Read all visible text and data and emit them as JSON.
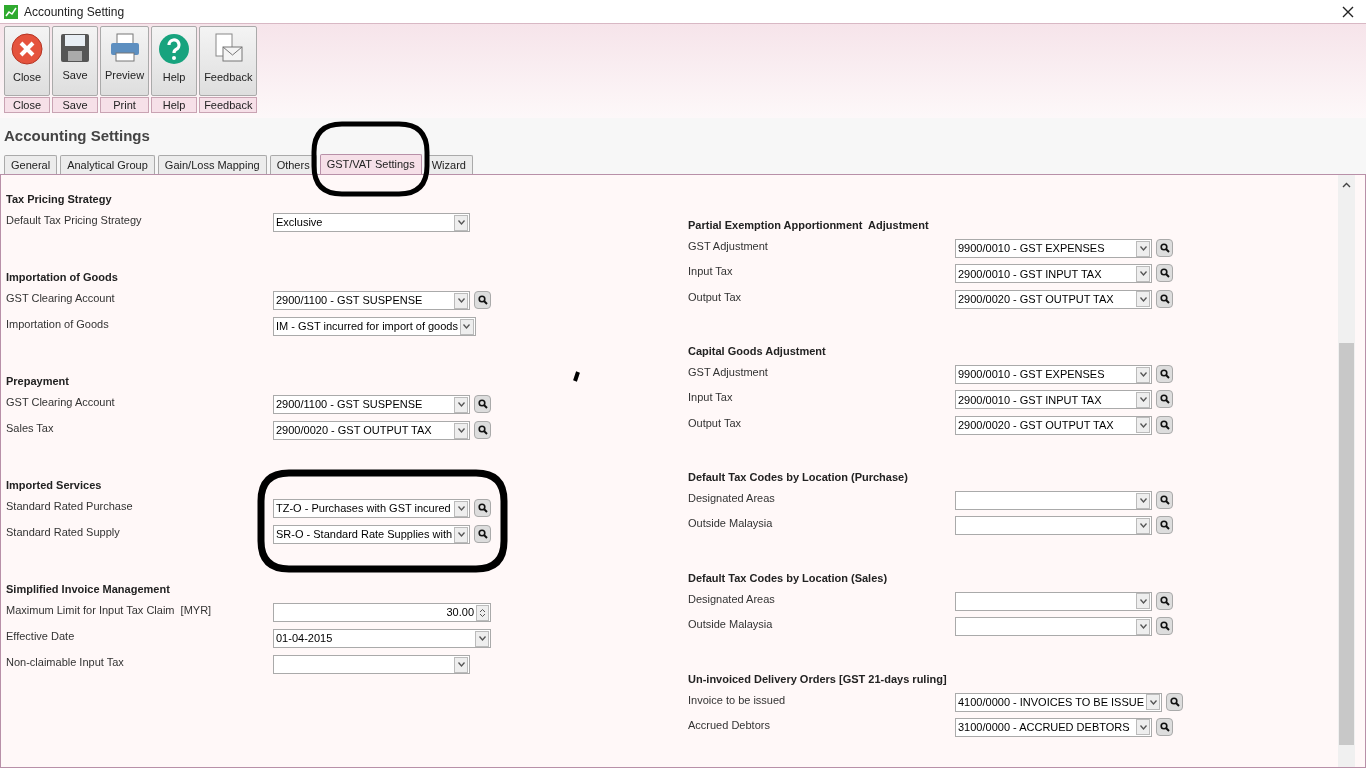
{
  "window": {
    "title": "Accounting Setting"
  },
  "toolbar": [
    {
      "label": "Close",
      "caption": "Close"
    },
    {
      "label": "Save",
      "caption": "Save"
    },
    {
      "label": "Preview",
      "caption": "Print"
    },
    {
      "label": "Help",
      "caption": "Help"
    },
    {
      "label": "Feedback",
      "caption": "Feedback"
    }
  ],
  "heading": "Accounting Settings",
  "tabs": [
    {
      "label": "General",
      "selected": false
    },
    {
      "label": "Analytical Group",
      "selected": false
    },
    {
      "label": "Gain/Loss Mapping",
      "selected": false
    },
    {
      "label": "Others",
      "selected": false
    },
    {
      "label": "GST/VAT Settings",
      "selected": true
    },
    {
      "label": "Wizard",
      "selected": false
    }
  ],
  "left_sections": [
    {
      "title": "Tax Pricing Strategy",
      "rows": [
        {
          "label": "Default Tax Pricing Strategy",
          "kind": "combo",
          "value": "Exclusive",
          "lookup": false
        }
      ]
    },
    {
      "title": "Importation of Goods",
      "rows": [
        {
          "label": "GST Clearing Account",
          "kind": "combo",
          "value": "2900/1100 - GST SUSPENSE",
          "lookup": true
        },
        {
          "label": "Importation of Goods",
          "kind": "combo",
          "value": "IM - GST incurred for import of goods",
          "lookup": false
        }
      ]
    },
    {
      "title": "Prepayment",
      "rows": [
        {
          "label": "GST Clearing Account",
          "kind": "combo",
          "value": "2900/1100 - GST SUSPENSE",
          "lookup": true
        },
        {
          "label": "Sales Tax",
          "kind": "combo",
          "value": "2900/0020 - GST OUTPUT TAX",
          "lookup": true
        }
      ]
    },
    {
      "title": "Imported Services",
      "rows": [
        {
          "label": "Standard Rated Purchase",
          "kind": "combo",
          "value": "TZ-O - Purchases with GST incured",
          "lookup": true
        },
        {
          "label": "Standard Rated Supply",
          "kind": "combo",
          "value": "SR-O - Standard Rate Supplies with",
          "lookup": true
        }
      ]
    },
    {
      "title": "Simplified Invoice Management",
      "rows": [
        {
          "label": "Maximum Limit for Input Tax Claim  [MYR]",
          "kind": "spin",
          "value": "30.00"
        },
        {
          "label": "Effective Date",
          "kind": "date",
          "value": "01-04-2015"
        },
        {
          "label": "Non-claimable Input Tax",
          "kind": "combo",
          "value": "",
          "lookup": false
        }
      ]
    }
  ],
  "right_sections": [
    {
      "title": "Partial Exemption Apportionment  Adjustment",
      "rows": [
        {
          "label": "GST Adjustment",
          "kind": "combo",
          "value": "9900/0010 - GST EXPENSES",
          "lookup": true
        },
        {
          "label": "Input Tax",
          "kind": "combo",
          "value": "2900/0010 - GST INPUT TAX",
          "lookup": true
        },
        {
          "label": "Output Tax",
          "kind": "combo",
          "value": "2900/0020 - GST OUTPUT TAX",
          "lookup": true
        }
      ]
    },
    {
      "title": "Capital Goods Adjustment",
      "rows": [
        {
          "label": "GST Adjustment",
          "kind": "combo",
          "value": "9900/0010 - GST EXPENSES",
          "lookup": true
        },
        {
          "label": "Input Tax",
          "kind": "combo",
          "value": "2900/0010 - GST INPUT TAX",
          "lookup": true
        },
        {
          "label": "Output Tax",
          "kind": "combo",
          "value": "2900/0020 - GST OUTPUT TAX",
          "lookup": true
        }
      ]
    },
    {
      "title": "Default Tax Codes by Location (Purchase)",
      "rows": [
        {
          "label": "Designated Areas",
          "kind": "combo",
          "value": "",
          "lookup": true
        },
        {
          "label": "Outside Malaysia",
          "kind": "combo",
          "value": "",
          "lookup": true
        }
      ]
    },
    {
      "title": "Default Tax Codes by Location (Sales)",
      "rows": [
        {
          "label": "Designated Areas",
          "kind": "combo",
          "value": "",
          "lookup": true
        },
        {
          "label": "Outside Malaysia",
          "kind": "combo",
          "value": "",
          "lookup": true
        }
      ]
    },
    {
      "title": "Un-invoiced Delivery Orders [GST 21-days ruling]",
      "rows": [
        {
          "label": "Invoice to be issued",
          "kind": "combo",
          "value": "4100/0000 - INVOICES TO BE ISSUE",
          "lookup": true
        },
        {
          "label": "Accrued Debtors",
          "kind": "combo",
          "value": "3100/0000 - ACCRUED DEBTORS",
          "lookup": true
        }
      ]
    }
  ],
  "annotations": [
    {
      "kind": "tab_ring"
    },
    {
      "kind": "section_ring"
    },
    {
      "kind": "stroke"
    }
  ]
}
